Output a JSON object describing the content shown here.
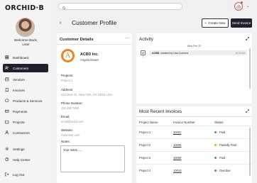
{
  "app": {
    "logo": "ORCHID·B"
  },
  "user": {
    "welcome": "Welcome Back,",
    "name": "Lisa!"
  },
  "sidebar": {
    "items": [
      {
        "label": "Dashboard",
        "icon": "dashboard-icon"
      },
      {
        "label": "Customers",
        "icon": "customers-icon",
        "active": true
      },
      {
        "label": "Vendors",
        "icon": "vendors-icon"
      },
      {
        "label": "Invoices",
        "icon": "invoices-icon"
      },
      {
        "label": "Products & Services",
        "icon": "products-icon"
      },
      {
        "label": "Payments",
        "icon": "payments-icon"
      },
      {
        "label": "Projects",
        "icon": "projects-icon"
      },
      {
        "label": "Contractors",
        "icon": "contractors-icon"
      }
    ],
    "bottom": [
      {
        "label": "Settings",
        "icon": "gear-icon"
      },
      {
        "label": "Help Center",
        "icon": "help-icon"
      },
      {
        "label": "Log Out",
        "icon": "logout-icon"
      }
    ]
  },
  "header": {
    "title": "Customer Profile",
    "create_label": "Create New",
    "send_label": "Send Invoice"
  },
  "details": {
    "title": "Customer Details",
    "menu": "···",
    "company_initial": "A",
    "company_name": "ACBD Inc.",
    "contact_name": "Angela Bower",
    "fields": [
      {
        "label": "Projects:",
        "value": "Project 1"
      },
      {
        "label": "Address:",
        "value": "123 Main St., New York, NY 10001 USA"
      },
      {
        "label": "Phone Number:",
        "value": "123 456 7890"
      },
      {
        "label": "Email:",
        "value": "email@acbd.com"
      },
      {
        "label": "Website:",
        "value": "Customer.com"
      }
    ],
    "notes_label": "Notes:",
    "notes_placeholder": "Your notes......"
  },
  "activity": {
    "title": "Activity",
    "date": "Wed Feb 22",
    "items": [
      {
        "actor": "ACBD",
        "text": "created by Lisa Connors",
        "time": "10:00 AM"
      }
    ]
  },
  "invoices": {
    "title": "Most Recent Invoices",
    "columns": [
      "Project Name",
      "Invoice Number",
      "Status"
    ],
    "rows": [
      {
        "project": "Project 1",
        "number": "10001",
        "status": "Paid",
        "color": "#3aa655"
      },
      {
        "project": "Project 2",
        "number": "10005",
        "status": "Partially Paid",
        "color": "#f0a732"
      },
      {
        "project": "Project 3",
        "number": "10009",
        "status": "Paid",
        "color": "#3aa655"
      },
      {
        "project": "Project 4",
        "number": "10010",
        "status": "Overdue",
        "color": "#d9534f"
      }
    ]
  },
  "colors": {
    "accent": "#231f2e",
    "logo_orange": "#e8852a",
    "notify": "#d9534f"
  }
}
